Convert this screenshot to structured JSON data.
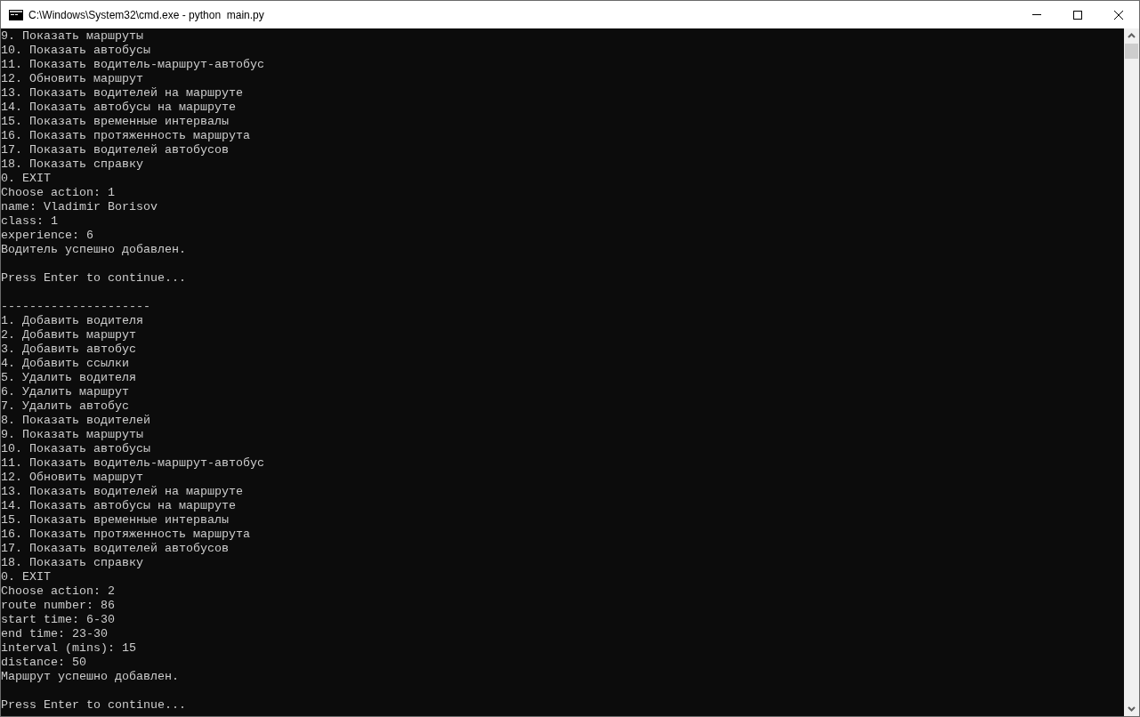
{
  "window": {
    "title": "C:\\Windows\\System32\\cmd.exe - python  main.py"
  },
  "console": {
    "lines": [
      {
        "kind": "text",
        "text": "9. Показать маршруты"
      },
      {
        "kind": "text",
        "text": "10. Показать автобусы"
      },
      {
        "kind": "text",
        "text": "11. Показать водитель-маршрут-автобус"
      },
      {
        "kind": "text",
        "text": "12. Обновить маршрут"
      },
      {
        "kind": "text",
        "text": "13. Показать водителей на маршруте"
      },
      {
        "kind": "text",
        "text": "14. Показать автобусы на маршруте"
      },
      {
        "kind": "text",
        "text": "15. Показать временные интервалы"
      },
      {
        "kind": "text",
        "text": "16. Показать протяженность маршрута"
      },
      {
        "kind": "text",
        "text": "17. Показать водителей автобусов"
      },
      {
        "kind": "text",
        "text": "18. Показать справку"
      },
      {
        "kind": "text",
        "text": "0. EXIT"
      },
      {
        "kind": "text",
        "text": "Choose action: 1"
      },
      {
        "kind": "text",
        "text": "name: Vladimir Borisov"
      },
      {
        "kind": "text",
        "text": "class: 1"
      },
      {
        "kind": "text",
        "text": "experience: 6"
      },
      {
        "kind": "text",
        "text": "Водитель успешно добавлен."
      },
      {
        "kind": "blank"
      },
      {
        "kind": "text",
        "text": "Press Enter to continue..."
      },
      {
        "kind": "blank"
      },
      {
        "kind": "text",
        "text": "---------------------"
      },
      {
        "kind": "text",
        "text": "1. Добавить водителя"
      },
      {
        "kind": "text",
        "text": "2. Добавить маршрут"
      },
      {
        "kind": "text",
        "text": "3. Добавить автобус"
      },
      {
        "kind": "text",
        "text": "4. Добавить ссылки"
      },
      {
        "kind": "text",
        "text": "5. Удалить водителя"
      },
      {
        "kind": "text",
        "text": "6. Удалить маршрут"
      },
      {
        "kind": "text",
        "text": "7. Удалить автобус"
      },
      {
        "kind": "text",
        "text": "8. Показать водителей"
      },
      {
        "kind": "text",
        "text": "9. Показать маршруты"
      },
      {
        "kind": "text",
        "text": "10. Показать автобусы"
      },
      {
        "kind": "text",
        "text": "11. Показать водитель-маршрут-автобус"
      },
      {
        "kind": "text",
        "text": "12. Обновить маршрут"
      },
      {
        "kind": "text",
        "text": "13. Показать водителей на маршруте"
      },
      {
        "kind": "text",
        "text": "14. Показать автобусы на маршруте"
      },
      {
        "kind": "text",
        "text": "15. Показать временные интервалы"
      },
      {
        "kind": "text",
        "text": "16. Показать протяженность маршрута"
      },
      {
        "kind": "text",
        "text": "17. Показать водителей автобусов"
      },
      {
        "kind": "text",
        "text": "18. Показать справку"
      },
      {
        "kind": "text",
        "text": "0. EXIT"
      },
      {
        "kind": "text",
        "text": "Choose action: 2"
      },
      {
        "kind": "text",
        "text": "route number: 86"
      },
      {
        "kind": "text",
        "text": "start time: 6-30"
      },
      {
        "kind": "text",
        "text": "end time: 23-30"
      },
      {
        "kind": "text",
        "text": "interval (mins): 15"
      },
      {
        "kind": "text",
        "text": "distance: 50"
      },
      {
        "kind": "text",
        "text": "Маршрут успешно добавлен."
      },
      {
        "kind": "blank"
      },
      {
        "kind": "text",
        "text": "Press Enter to continue..."
      }
    ]
  }
}
